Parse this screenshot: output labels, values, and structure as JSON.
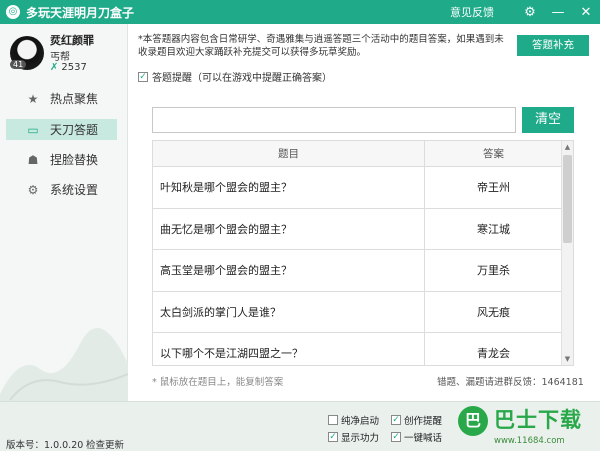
{
  "titlebar": {
    "title": "多玩天涯明月刀盒子",
    "feedback": "意见反馈",
    "settings_icon": "gear-icon",
    "minimize_glyph": "—",
    "close_glyph": "✕"
  },
  "user": {
    "level": "41",
    "name": "烎红颜罪",
    "guild": "丐帮",
    "score": "2537"
  },
  "nav": [
    {
      "label": "热点聚焦",
      "icon": "star-icon",
      "glyph": "★"
    },
    {
      "label": "天刀答题",
      "icon": "screen-icon",
      "glyph": "▭"
    },
    {
      "label": "捏脸替换",
      "icon": "mask-icon",
      "glyph": "☗"
    },
    {
      "label": "系统设置",
      "icon": "gear-icon",
      "glyph": "⚙"
    }
  ],
  "notice": "*本答题器内容包含日常研学、奇遇雅集与逍遥答题三个活动中的题目答案，如果遇到未收录题目欢迎大家踊跃补充提交可以获得多玩草奖励。",
  "supplement_button": "答题补充",
  "hint": {
    "checked": true,
    "label": "答题提醒（可以在游戏中提醒正确答案）"
  },
  "search": {
    "value": "",
    "placeholder": ""
  },
  "clear_button": "清空",
  "table": {
    "headers": [
      "题目",
      "答案"
    ],
    "rows": [
      {
        "q": "叶知秋是哪个盟会的盟主？",
        "a": "帝王州"
      },
      {
        "q": "曲无忆是哪个盟会的盟主？",
        "a": "寒江城"
      },
      {
        "q": "高玉堂是哪个盟会的盟主？",
        "a": "万里杀"
      },
      {
        "q": "太白剑派的掌门人是谁？",
        "a": "风无痕"
      },
      {
        "q": "以下哪个不是江湖四盟之一？",
        "a": "青龙会"
      }
    ]
  },
  "footer": {
    "tip": "* 鼠标放在题目上，能复制答案",
    "feedback": "错题、漏题请进群反馈：1464181"
  },
  "bottom": {
    "version": "版本号：1.0.0.20",
    "check_update": "检查更新",
    "options": [
      {
        "label": "纯净启动",
        "checked": false
      },
      {
        "label": "创作提醒",
        "checked": true
      },
      {
        "label": "显示功力",
        "checked": true
      },
      {
        "label": "一键喊话",
        "checked": true
      }
    ]
  },
  "watermark": {
    "title": "巴士下载",
    "url": "www.11684.com",
    "glyph": "巴"
  }
}
